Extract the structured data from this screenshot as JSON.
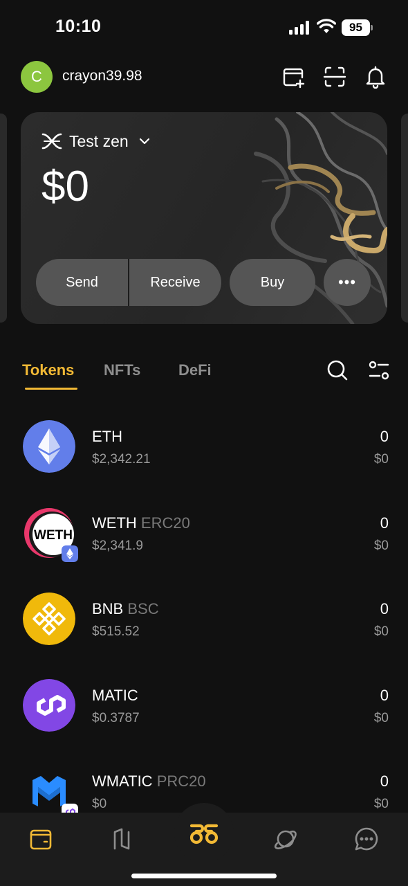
{
  "status_bar": {
    "time": "10:10",
    "battery": "95"
  },
  "header": {
    "avatar_letter": "C",
    "username": "crayon39.98",
    "avatar_color": "#8cc63f"
  },
  "wallet_card": {
    "wallet_name": "Test zen",
    "balance": "$0",
    "actions": {
      "send": "Send",
      "receive": "Receive",
      "buy": "Buy",
      "more": "•••"
    }
  },
  "tabs": [
    {
      "label": "Tokens",
      "active": true
    },
    {
      "label": "NFTs",
      "active": false
    },
    {
      "label": "DeFi",
      "active": false
    }
  ],
  "tokens": [
    {
      "symbol": "ETH",
      "network": "",
      "price": "$2,342.21",
      "amount": "0",
      "value": "$0",
      "icon": "eth-icon"
    },
    {
      "symbol": "WETH",
      "network": "ERC20",
      "price": "$2,341.9",
      "amount": "0",
      "value": "$0",
      "icon": "weth-icon",
      "logo_text": "WETH"
    },
    {
      "symbol": "BNB",
      "network": "BSC",
      "price": "$515.52",
      "amount": "0",
      "value": "$0",
      "icon": "bnb-icon"
    },
    {
      "symbol": "MATIC",
      "network": "",
      "price": "$0.3787",
      "amount": "0",
      "value": "$0",
      "icon": "matic-icon"
    },
    {
      "symbol": "WMATIC",
      "network": "PRC20",
      "price": "$0",
      "amount": "0",
      "value": "$0",
      "icon": "wmatic-icon"
    }
  ],
  "colors": {
    "accent": "#f2b935",
    "background": "#111111",
    "eth": "#627eea",
    "bnb": "#f0b90b",
    "matic": "#8247e5"
  }
}
